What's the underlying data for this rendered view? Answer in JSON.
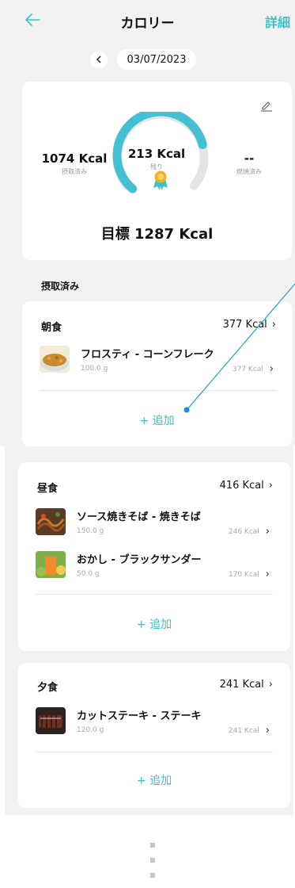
{
  "header": {
    "title": "カロリー",
    "details_label": "詳細"
  },
  "date": {
    "value": "03/07/2023"
  },
  "summary": {
    "consumed_value": "1074 Kcal",
    "consumed_label": "摂取済み",
    "remaining_value": "213 Kcal",
    "remaining_label": "残り",
    "burned_value": "--",
    "burned_label": "燃焼済み",
    "goal": "目標 1287 Kcal",
    "progress_fraction": 0.83
  },
  "section_label": "摂取済み",
  "meals": [
    {
      "title": "朝食",
      "total": "377 Kcal",
      "add_label": "+ 追加",
      "foods": [
        {
          "name": "フロスティ - コーンフレーク",
          "amount": "100.0 g",
          "kcal": "377 Kcal"
        }
      ]
    },
    {
      "title": "昼食",
      "total": "416 Kcal",
      "add_label": "+ 追加",
      "foods": [
        {
          "name": "ソース焼きそば - 焼きそば",
          "amount": "150.0 g",
          "kcal": "246 Kcal"
        },
        {
          "name": "おかし - ブラックサンダー",
          "amount": "50.0 g",
          "kcal": "170 Kcal"
        }
      ]
    },
    {
      "title": "夕食",
      "total": "241 Kcal",
      "add_label": "+ 追加",
      "foods": [
        {
          "name": "カットステーキ - ステーキ",
          "amount": "120.0 g",
          "kcal": "241 Kcal"
        }
      ]
    }
  ],
  "colors": {
    "accent": "#3fc1c9",
    "background": "#f2f2f2"
  },
  "icons": {
    "back": "arrow-left-icon",
    "edit": "pencil-icon",
    "badge": "medal-icon",
    "chevron": "chevron-right-icon"
  }
}
